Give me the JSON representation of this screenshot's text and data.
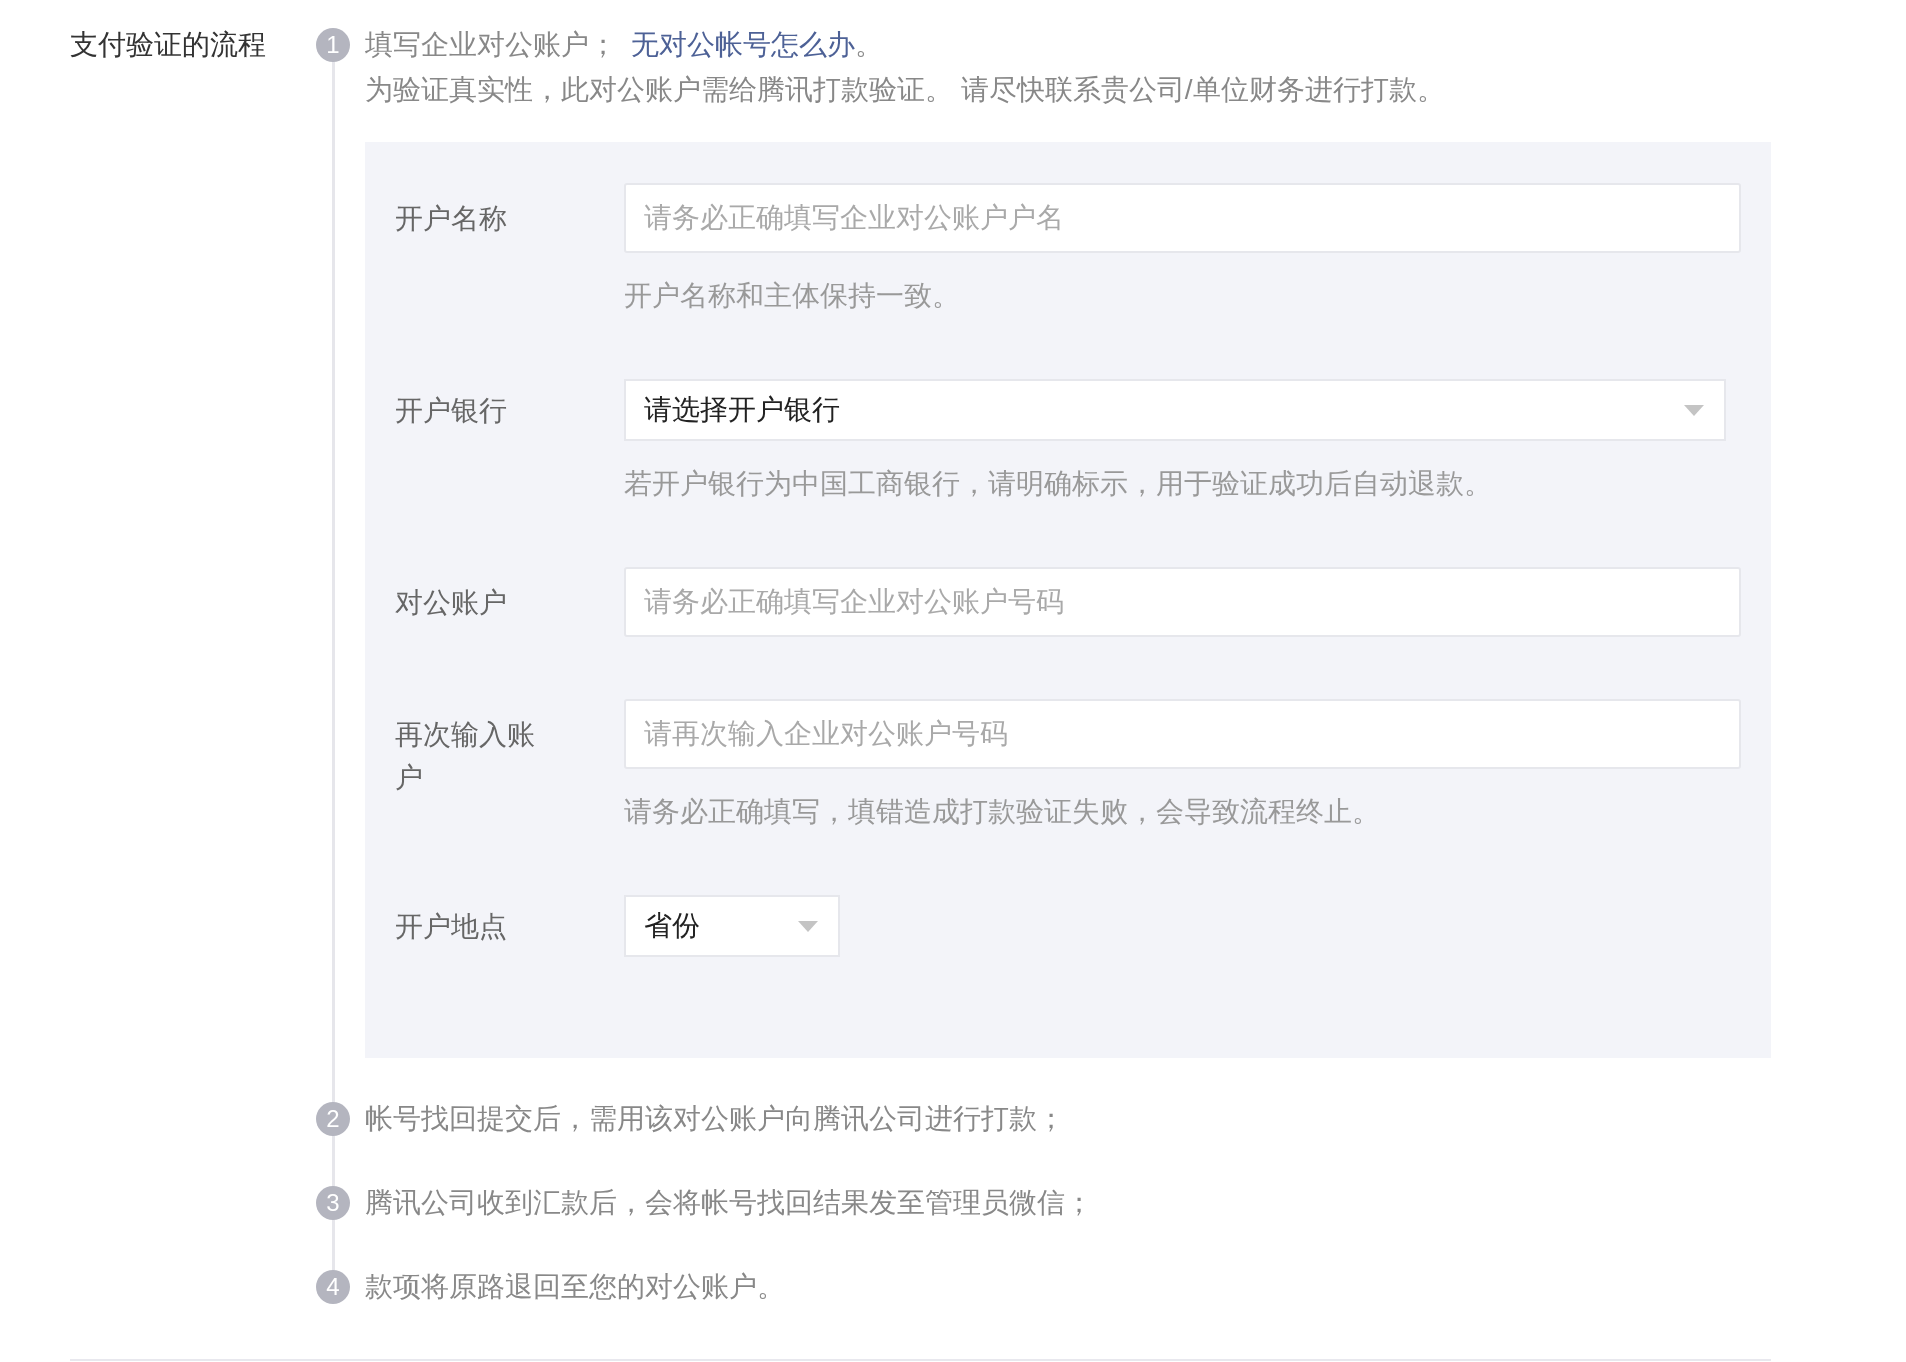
{
  "section_label": "支付验证的流程",
  "steps": [
    {
      "number": "1",
      "text": "填写企业对公账户；",
      "link": "无对公帐号怎么办",
      "link_suffix": "。",
      "note": "为验证真实性，此对公账户需给腾讯打款验证。 请尽快联系贵公司/单位财务进行打款。",
      "form": {
        "fields": [
          {
            "kind": "input",
            "label": "开户名称",
            "placeholder": "请务必正确填写企业对公账户户名",
            "hint": "开户名称和主体保持一致。"
          },
          {
            "kind": "select",
            "label": "开户银行",
            "value": "请选择开户银行",
            "hint": "若开户银行为中国工商银行，请明确标示，用于验证成功后自动退款。"
          },
          {
            "kind": "input",
            "label": "对公账户",
            "placeholder": "请务必正确填写企业对公账户号码"
          },
          {
            "kind": "input",
            "label": "再次输入账户",
            "placeholder": "请再次输入企业对公账户号码",
            "hint": "请务必正确填写，填错造成打款验证失败，会导致流程终止。"
          },
          {
            "kind": "compact-select",
            "label": "开户地点",
            "value": "省份"
          }
        ]
      }
    },
    {
      "number": "2",
      "text": "帐号找回提交后，需用该对公账户向腾讯公司进行打款；"
    },
    {
      "number": "3",
      "text": "腾讯公司收到汇款后，会将帐号找回结果发至管理员微信；"
    },
    {
      "number": "4",
      "text": "款项将原路退回至您的对公账户。"
    }
  ]
}
